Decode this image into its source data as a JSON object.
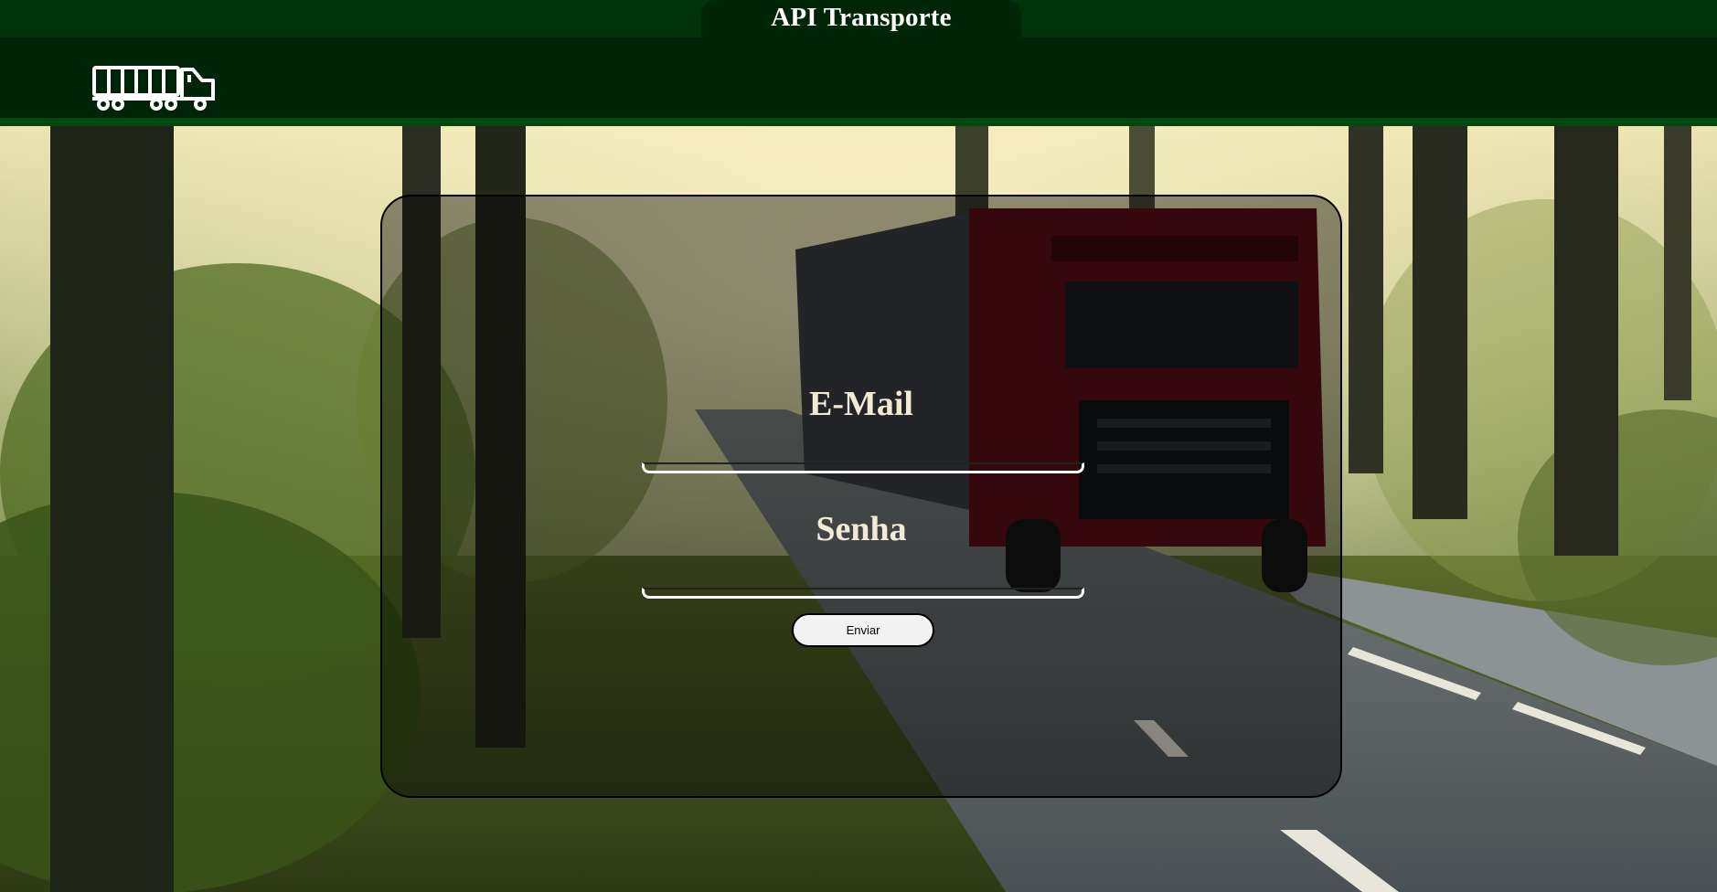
{
  "header": {
    "title": "API Transporte",
    "logo_icon": "truck-icon",
    "colors": {
      "top_bar": "#003309",
      "main_bar": "#002408",
      "stripe": "#004a10"
    }
  },
  "form": {
    "email_label": "E-Mail",
    "email_value": "",
    "password_label": "Senha",
    "password_value": "",
    "submit_label": "Enviar"
  },
  "background": {
    "scene_icon": "forest-road-truck-photo"
  }
}
